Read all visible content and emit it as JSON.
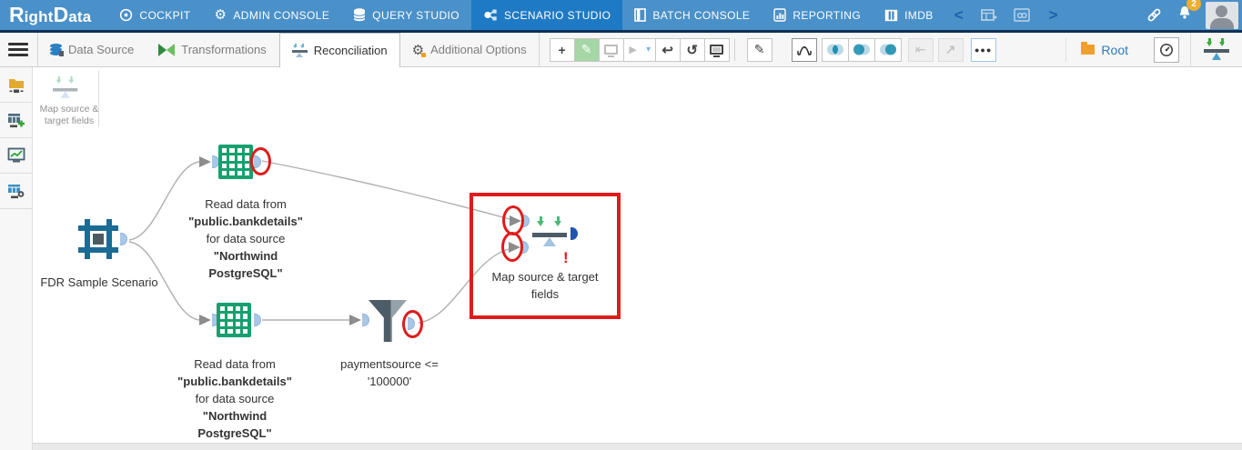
{
  "topbar": {
    "logo": {
      "r": "R",
      "ight": "ight",
      "d": "D",
      "ata": "ata"
    },
    "nav": [
      {
        "label": "COCKPIT"
      },
      {
        "label": "ADMIN CONSOLE"
      },
      {
        "label": "QUERY STUDIO"
      },
      {
        "label": "SCENARIO STUDIO"
      },
      {
        "label": "BATCH CONSOLE"
      },
      {
        "label": "REPORTING"
      },
      {
        "label": "IMDB"
      }
    ],
    "active_item": "SCENARIO STUDIO",
    "chevron_left": "<",
    "chevron_right": ">",
    "notification_badge": "2"
  },
  "toolbar": {
    "tabs": [
      {
        "label": "Data Source"
      },
      {
        "label": "Transformations"
      },
      {
        "label": "Reconciliation"
      },
      {
        "label": "Additional Options"
      }
    ],
    "active_tab": "Reconciliation",
    "buttons": {
      "plus": "+",
      "edit": "✎",
      "play": "▶",
      "caret": "▾",
      "undo": "↩",
      "history": "↺",
      "note": "✎",
      "collapse": "⇤",
      "open_external": "↗",
      "more": "●●●"
    },
    "root_label": "Root"
  },
  "palette": {
    "map_item": {
      "line1": "Map source &",
      "line2": "target fields"
    }
  },
  "canvas": {
    "scenario_node": {
      "label": "FDR Sample Scenario"
    },
    "read_top": {
      "lines": [
        "Read data from",
        "\"public.bankdetails\"",
        "for data source",
        "\"Northwind",
        "PostgreSQL\""
      ]
    },
    "read_bottom": {
      "lines": [
        "Read data from",
        "\"public.bankdetails\"",
        "for data source",
        "\"Northwind",
        "PostgreSQL\""
      ]
    },
    "filter_node": {
      "line1": "paymentsource <=",
      "line2": "'100000'"
    },
    "map_node": {
      "line1": "Map source & target",
      "line2": "fields",
      "error_mark": "!"
    }
  },
  "colors": {
    "topbar_bg": "#4a90c9",
    "topbar_active_bg": "#1e7ac4",
    "annotation_red": "#e01b1b",
    "table_icon_green": "#17a06d",
    "accent_blue": "#2b7bc0",
    "edit_button_green": "#a5d6a5"
  }
}
